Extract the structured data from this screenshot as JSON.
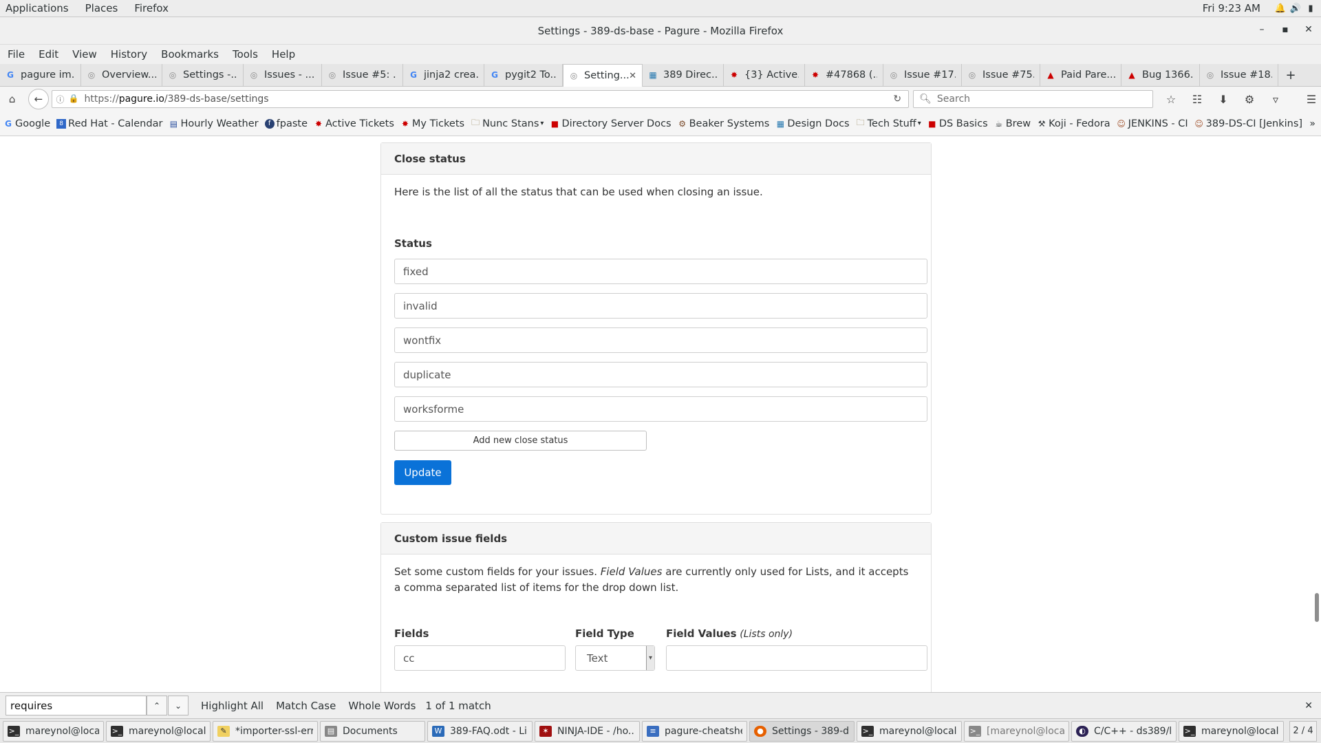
{
  "topbar": {
    "applications": "Applications",
    "places": "Places",
    "firefox": "Firefox",
    "clock": "Fri  9:23 AM",
    "icons": [
      "bell-icon",
      "volume-icon",
      "battery-icon"
    ]
  },
  "window": {
    "title": "Settings - 389-ds-base - Pagure - Mozilla Firefox"
  },
  "menu": [
    "File",
    "Edit",
    "View",
    "History",
    "Bookmarks",
    "Tools",
    "Help"
  ],
  "tabs": [
    {
      "label": "pagure im...",
      "icon": "G"
    },
    {
      "label": "Overview...",
      "icon": "pagure"
    },
    {
      "label": "Settings -...",
      "icon": "pagure"
    },
    {
      "label": "Issues - ...",
      "icon": "pagure"
    },
    {
      "label": "Issue #5: ...",
      "icon": "pagure"
    },
    {
      "label": "jinja2 crea...",
      "icon": "G"
    },
    {
      "label": "pygit2 To...",
      "icon": "G"
    },
    {
      "label": "Setting...",
      "icon": "pagure"
    },
    {
      "label": "389 Direc...",
      "icon": "grid"
    },
    {
      "label": "{3} Active...",
      "icon": "bug"
    },
    {
      "label": "#47868 (...",
      "icon": "bug"
    },
    {
      "label": "Issue #17...",
      "icon": "pagure"
    },
    {
      "label": "Issue #75...",
      "icon": "pagure"
    },
    {
      "label": "Paid Pare...",
      "icon": "redhat"
    },
    {
      "label": "Bug 1366...",
      "icon": "redhat"
    },
    {
      "label": "Issue #18...",
      "icon": "pagure"
    }
  ],
  "nav": {
    "url_scheme": "https://",
    "url_host": "pagure.io",
    "url_path": "/389-ds-base/settings",
    "search_placeholder": "Search"
  },
  "bookmarks": [
    "Google",
    "Red Hat - Calendar",
    "Hourly Weather",
    "fpaste",
    "Active Tickets",
    "My Tickets",
    "Nunc Stans",
    "Directory Server Docs",
    "Beaker Systems",
    "Design Docs",
    "Tech Stuff",
    "DS Basics",
    "Brew",
    "Koji - Fedora",
    "JENKINS - CI",
    "389-DS-CI [Jenkins]"
  ],
  "close_status": {
    "header": "Close status",
    "description": "Here is the list of all the status that can be used when closing an issue.",
    "status_label": "Status",
    "statuses": [
      "fixed",
      "invalid",
      "wontfix",
      "duplicate",
      "worksforme"
    ],
    "add_button": "Add new close status",
    "update_button": "Update"
  },
  "custom_fields": {
    "header": "Custom issue fields",
    "description_prefix": "Set some custom fields for your issues. ",
    "description_em": "Field Values",
    "description_suffix": " are currently only used for Lists, and it accepts a comma separated list of items for the drop down list.",
    "col_fields": "Fields",
    "col_type": "Field Type",
    "col_values": "Field Values",
    "col_values_note": "(Lists only)",
    "row_field": "cc",
    "row_type": "Text",
    "row_values": ""
  },
  "findbar": {
    "query": "requires",
    "highlight_all": "Highlight All",
    "match_case": "Match Case",
    "whole_words": "Whole Words",
    "result": "1 of 1 match"
  },
  "taskbar": [
    {
      "label": "mareynol@local...",
      "icon": "terminal-icon"
    },
    {
      "label": "mareynol@local...",
      "icon": "terminal-icon"
    },
    {
      "label": "*importer-ssl-err...",
      "icon": "editor-icon"
    },
    {
      "label": "Documents",
      "icon": "folder-icon"
    },
    {
      "label": "389-FAQ.odt - Li...",
      "icon": "writer-icon"
    },
    {
      "label": "NINJA-IDE - /ho...",
      "icon": "ninja-icon"
    },
    {
      "label": "pagure-cheatshe...",
      "icon": "doc-icon"
    },
    {
      "label": "Settings - 389-d...",
      "icon": "firefox-icon"
    },
    {
      "label": "mareynol@local...",
      "icon": "terminal-icon"
    },
    {
      "label": "[mareynol@loca...",
      "icon": "terminal-icon"
    },
    {
      "label": "C/C++ - ds389/l...",
      "icon": "eclipse-icon"
    },
    {
      "label": "mareynol@local...",
      "icon": "terminal-icon"
    }
  ],
  "workspace": "2 / 4",
  "colors": {
    "primary_button": "#0a72d8",
    "card_header_bg": "#f5f5f5"
  }
}
